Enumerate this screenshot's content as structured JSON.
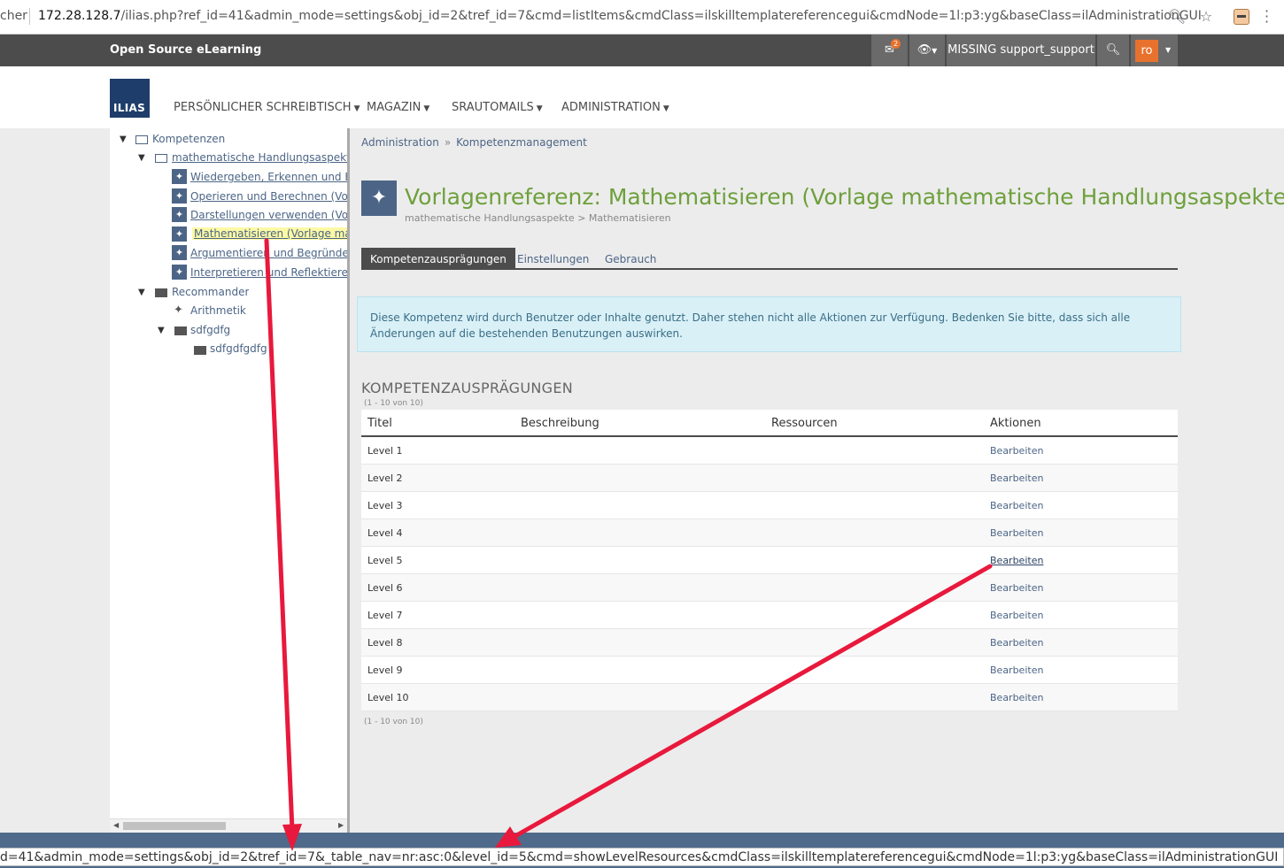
{
  "browser": {
    "prefix": "cher",
    "url_host": "172.28.128.7",
    "url_rest": "/ilias.php?ref_id=41&admin_mode=settings&obj_id=2&tref_id=7&cmd=listItems&cmdClass=ilskilltemplatereferencegui&cmdNode=1l:p3:yg&baseClass=ilAdministrationGUI",
    "icons": [
      "zoom-icon",
      "star-icon",
      "extension-icon",
      "menu-icon"
    ]
  },
  "topbar": {
    "site_name": "Open Source eLearning",
    "mail_badge": "2",
    "user_label": "MISSING support_support",
    "avatar": "ro"
  },
  "header": {
    "logo": "ILIAS",
    "nav": [
      "PERSÖNLICHER SCHREIBTISCH",
      "MAGAZIN",
      "SRAUTOMAILS",
      "ADMINISTRATION"
    ]
  },
  "tree": {
    "root": "Kompetenzen",
    "group1": "mathematische Handlungsaspekte",
    "skills": [
      "Wiedergeben, Erkennen und Beschreiben",
      "Operieren und Berechnen (Vorlage mathematische Handlungsaspekte)",
      "Darstellungen verwenden (Vorlage mathematische Handlungsaspekte)",
      "Mathematisieren (Vorlage mathematische Handlungsaspekte)",
      "Argumentieren und Begründen (Vorlage mathematische Handlungsaspekte)",
      "Interpretieren und Reflektieren (Vorlage mathematische Handlungsaspekte)"
    ],
    "group2": "Recommander",
    "arithmetik": "Arithmetik",
    "sub1": "sdfgdfg",
    "sub2": "sdfgdfgdfg"
  },
  "content": {
    "breadcrumb": [
      "Administration",
      "Kompetenzmanagement"
    ],
    "breadcrumb_sep": "»",
    "title": "Vorlagenreferenz: Mathematisieren (Vorlage mathematische Handlungsaspekte)",
    "subtitle": "mathematische Handlungsaspekte > Mathematisieren",
    "tabs": [
      "Kompetenzausprägungen",
      "Einstellungen",
      "Gebrauch"
    ],
    "info": "Diese Kompetenz wird durch Benutzer oder Inhalte genutzt. Daher stehen nicht alle Aktionen zur Verfügung. Bedenken Sie bitte, dass sich alle Änderungen auf die bestehenden Benutzungen auswirken.",
    "section_title": "KOMPETENZAUSPRÄGUNGEN",
    "count": "(1 - 10 von 10)",
    "columns": [
      "Titel",
      "Beschreibung",
      "Ressourcen",
      "Aktionen"
    ],
    "rows": [
      {
        "title": "Level 1",
        "action": "Bearbeiten"
      },
      {
        "title": "Level 2",
        "action": "Bearbeiten"
      },
      {
        "title": "Level 3",
        "action": "Bearbeiten"
      },
      {
        "title": "Level 4",
        "action": "Bearbeiten"
      },
      {
        "title": "Level 5",
        "action": "Bearbeiten"
      },
      {
        "title": "Level 6",
        "action": "Bearbeiten"
      },
      {
        "title": "Level 7",
        "action": "Bearbeiten"
      },
      {
        "title": "Level 8",
        "action": "Bearbeiten"
      },
      {
        "title": "Level 9",
        "action": "Bearbeiten"
      },
      {
        "title": "Level 10",
        "action": "Bearbeiten"
      }
    ]
  },
  "status_url": "d=41&admin_mode=settings&obj_id=2&tref_id=7&_table_nav=nr:asc:0&level_id=5&cmd=showLevelResources&cmdClass=ilskilltemplatereferencegui&cmdNode=1l:p3:yg&baseClass=ilAdministrationGUI",
  "colors": {
    "annotation_arrow": "#e8193c",
    "title_green": "#6ea03c",
    "link_blue": "#4c6586",
    "topbar": "#4c4c4c"
  }
}
